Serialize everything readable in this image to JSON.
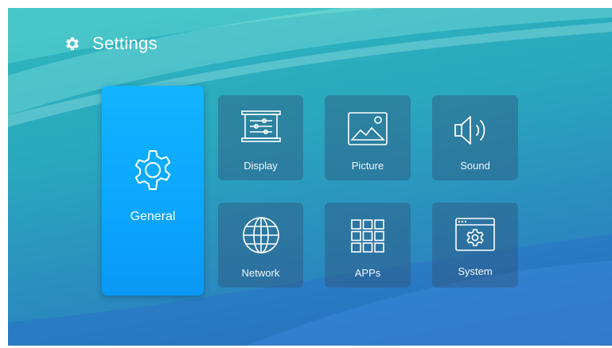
{
  "header": {
    "title": "Settings",
    "icon": "gear-icon"
  },
  "tiles": {
    "general": {
      "label": "General",
      "icon": "gear-icon"
    },
    "display": {
      "label": "Display",
      "icon": "display-sliders-icon"
    },
    "picture": {
      "label": "Picture",
      "icon": "picture-icon"
    },
    "sound": {
      "label": "Sound",
      "icon": "speaker-icon"
    },
    "network": {
      "label": "Network",
      "icon": "globe-icon"
    },
    "apps": {
      "label": "APPs",
      "icon": "apps-grid-icon"
    },
    "system": {
      "label": "System",
      "icon": "system-window-icon"
    }
  },
  "colors": {
    "selected_tile": "#0aa6ff",
    "tile_bg": "#3a6a8f",
    "bg_teal": "#2fb8bf",
    "bg_blue": "#2c6bb6"
  }
}
